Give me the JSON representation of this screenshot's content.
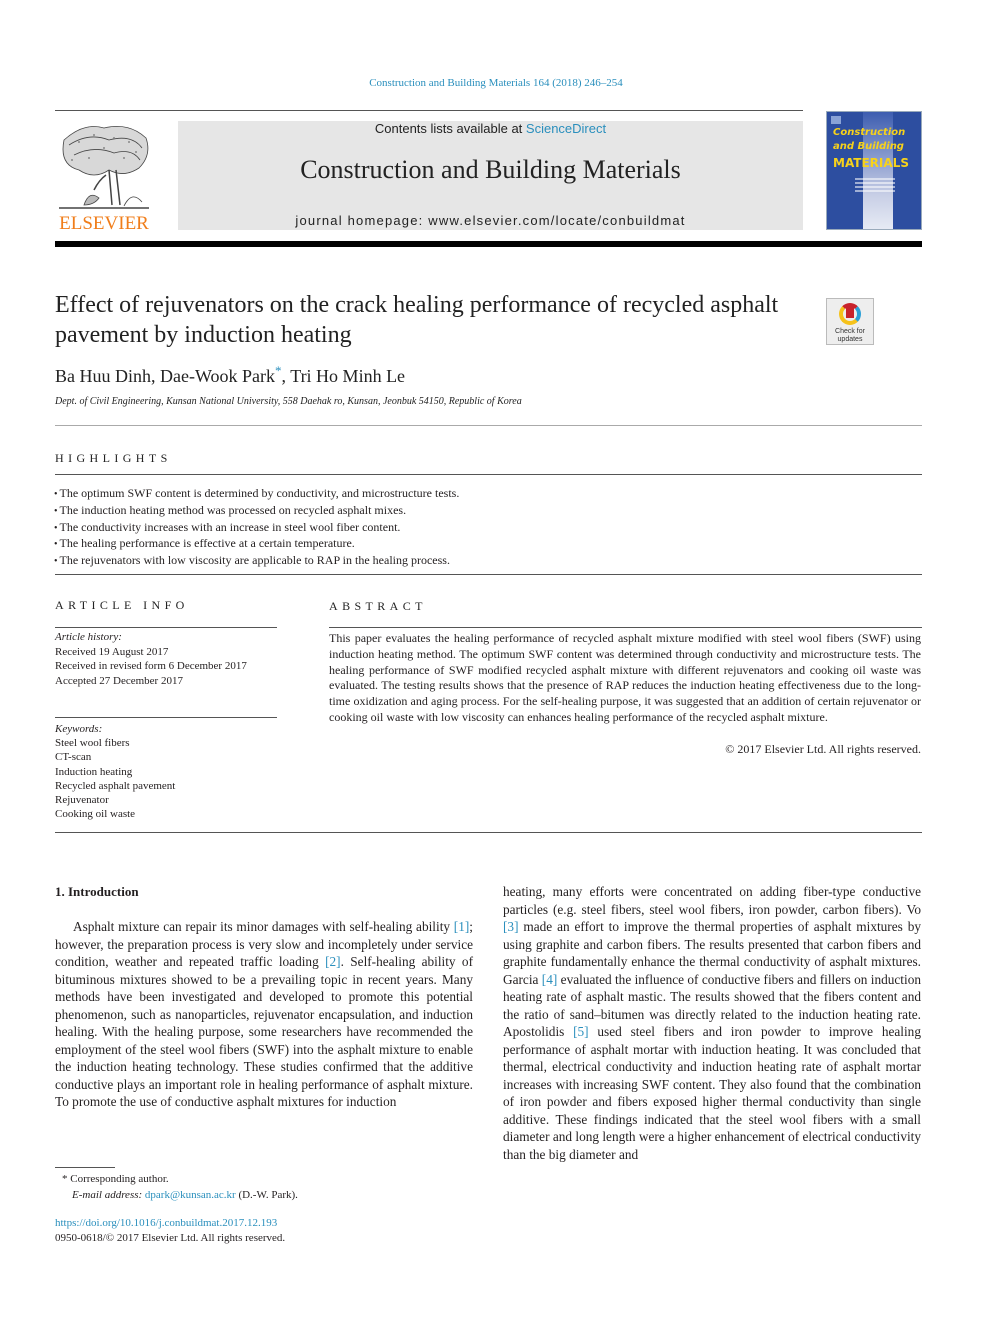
{
  "header": {
    "journal_reference": "Construction and Building Materials 164 (2018) 246–254",
    "publisher_logo_text": "ELSEVIER",
    "contents_prefix": "Contents lists available at ",
    "contents_link": "ScienceDirect",
    "journal_title": "Construction and Building Materials",
    "homepage_line": "journal homepage: www.elsevier.com/locate/conbuildmat",
    "cover": {
      "title_line1": "Construction",
      "title_line2": "and Building",
      "title_line3": "MATERIALS",
      "background_color": "#2d4ea0",
      "title_color": "#f7d21b"
    },
    "accent_color": "#2a8fbd",
    "logo_color": "#f07d1a"
  },
  "article": {
    "title": "Effect of rejuvenators on the crack healing performance of recycled asphalt pavement by induction heating",
    "crossmark_label_1": "Check for",
    "crossmark_label_2": "updates",
    "authors": [
      {
        "name": "Ba Huu Dinh",
        "marker": ""
      },
      {
        "name": "Dae-Wook Park",
        "marker": "*"
      },
      {
        "name": "Tri Ho Minh Le",
        "marker": ""
      }
    ],
    "author_sep": ", ",
    "affiliation": "Dept. of Civil Engineering, Kunsan National University, 558 Daehak ro, Kunsan, Jeonbuk 54150, Republic of Korea"
  },
  "highlights": {
    "heading": "HIGHLIGHTS",
    "items": [
      "The optimum SWF content is determined by conductivity, and microstructure tests.",
      "The induction heating method was processed on recycled asphalt mixes.",
      "The conductivity increases with an increase in steel wool fiber content.",
      "The healing performance is effective at a certain temperature.",
      "The rejuvenators with low viscosity are applicable to RAP in the healing process."
    ]
  },
  "article_info": {
    "heading": "ARTICLE INFO",
    "history_label": "Article history:",
    "history": [
      "Received 19 August 2017",
      "Received in revised form 6 December 2017",
      "Accepted 27 December 2017"
    ],
    "keywords_label": "Keywords:",
    "keywords": [
      "Steel wool fibers",
      "CT-scan",
      "Induction heating",
      "Recycled asphalt pavement",
      "Rejuvenator",
      "Cooking oil waste"
    ]
  },
  "abstract": {
    "heading": "ABSTRACT",
    "text": "This paper evaluates the healing performance of recycled asphalt mixture modified with steel wool fibers (SWF) using induction heating method. The optimum SWF content was determined through conductivity and microstructure tests. The healing performance of SWF modified recycled asphalt mixture with different rejuvenators and cooking oil waste was evaluated. The testing results shows that the presence of RAP reduces the induction heating effectiveness due to the long-time oxidization and aging process. For the self-healing purpose, it was suggested that an addition of certain rejuvenator or cooking oil waste with low viscosity can enhances healing performance of the recycled asphalt mixture.",
    "copyright": "© 2017 Elsevier Ltd. All rights reserved."
  },
  "body": {
    "section_heading": "1. Introduction",
    "left_column": [
      {
        "t": "Asphalt mixture can repair its minor damages with self-healing ability "
      },
      {
        "c": "[1]"
      },
      {
        "t": "; however, the preparation process is very slow and incompletely under service condition, weather and repeated traffic loading "
      },
      {
        "c": "[2]"
      },
      {
        "t": ". Self-healing ability of bituminous mixtures showed to be a prevailing topic in recent years. Many methods have been investigated and developed to promote this potential phenomenon, such as nanoparticles, rejuvenator encapsulation, and induction healing. With the healing purpose, some researchers have recommended the employment of the steel wool fibers (SWF) into the asphalt mixture to enable the induction heating technology. These studies confirmed that the additive conductive plays an important role in healing performance of asphalt mixture. To promote the use of conductive asphalt mixtures for induction"
      }
    ],
    "right_column": [
      {
        "t": "heating, many efforts were concentrated on adding fiber-type conductive particles (e.g. steel fibers, steel wool fibers, iron powder, carbon fibers). Vo "
      },
      {
        "c": "[3]"
      },
      {
        "t": " made an effort to improve the thermal properties of asphalt mixtures by using graphite and carbon fibers. The results presented that carbon fibers and graphite fundamentally enhance the thermal conductivity of asphalt mixtures. Garcia "
      },
      {
        "c": "[4]"
      },
      {
        "t": " evaluated the influence of conductive fibers and fillers on induction heating rate of asphalt mastic. The results showed that the fibers content and the ratio of sand–bitumen was directly related to the induction heating rate. Apostolidis "
      },
      {
        "c": "[5]"
      },
      {
        "t": " used steel fibers and iron powder to improve healing performance of asphalt mortar with induction heating. It was concluded that thermal, electrical conductivity and induction heating rate of asphalt mortar increases with increasing SWF content. They also found that the combination of iron powder and fibers exposed higher thermal conductivity than single additive. These findings indicated that the steel wool fibers with a small diameter and long length were a higher enhancement of electrical conductivity than the big diameter and"
      }
    ]
  },
  "footnote": {
    "marker": "*",
    "corresponding": "Corresponding author.",
    "email_label": "E-mail address:",
    "email": "dpark@kunsan.ac.kr",
    "email_suffix": " (D.-W. Park)."
  },
  "doi": {
    "url": "https://doi.org/10.1016/j.conbuildmat.2017.12.193",
    "issn_line": "0950-0618/© 2017 Elsevier Ltd. All rights reserved."
  }
}
